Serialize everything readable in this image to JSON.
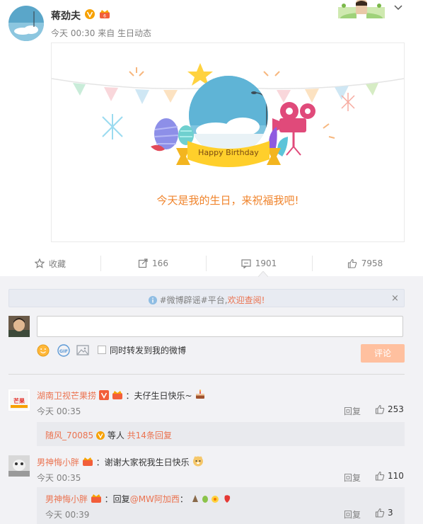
{
  "post": {
    "username": "蒋劲夫",
    "meta": "今天 00:30 来自 生日动态",
    "card_text": "今天是我的生日，来祝福我吧!",
    "birthday_banner": "Happy Birthday"
  },
  "actions": {
    "favorite": "收藏",
    "repost": "166",
    "comment": "1901",
    "like": "7958"
  },
  "notice": {
    "prefix": "#微博辟谣#平台,",
    "link": "欢迎查阅!",
    "close": "×"
  },
  "composer": {
    "input_value": "",
    "forward_label": "同时转发到我的微博",
    "submit": "评论"
  },
  "comments": [
    {
      "user": "湖南卫视芒果捞",
      "text": "：夫仔生日快乐~",
      "time": "今天 00:35",
      "reply": "回复",
      "likes": "253",
      "sub": {
        "user": "随风_70085",
        "mid": " 等人 ",
        "link": "共14条回复"
      }
    },
    {
      "user": "男神悔小胖",
      "text": "：谢谢大家祝我生日快乐",
      "time": "今天 00:35",
      "reply": "回复",
      "likes": "110",
      "sub": {
        "user": "男神悔小胖",
        "text": "：回复",
        "mention": "@MW阿加西",
        "text2": "：",
        "time": "今天 00:39",
        "reply": "回复",
        "likes": "3"
      }
    }
  ],
  "colors": {
    "accent": "#eb7350",
    "card_text": "#f0842c",
    "button_disabled": "#ffc09f",
    "comment_bg": "#f2f2f5"
  }
}
